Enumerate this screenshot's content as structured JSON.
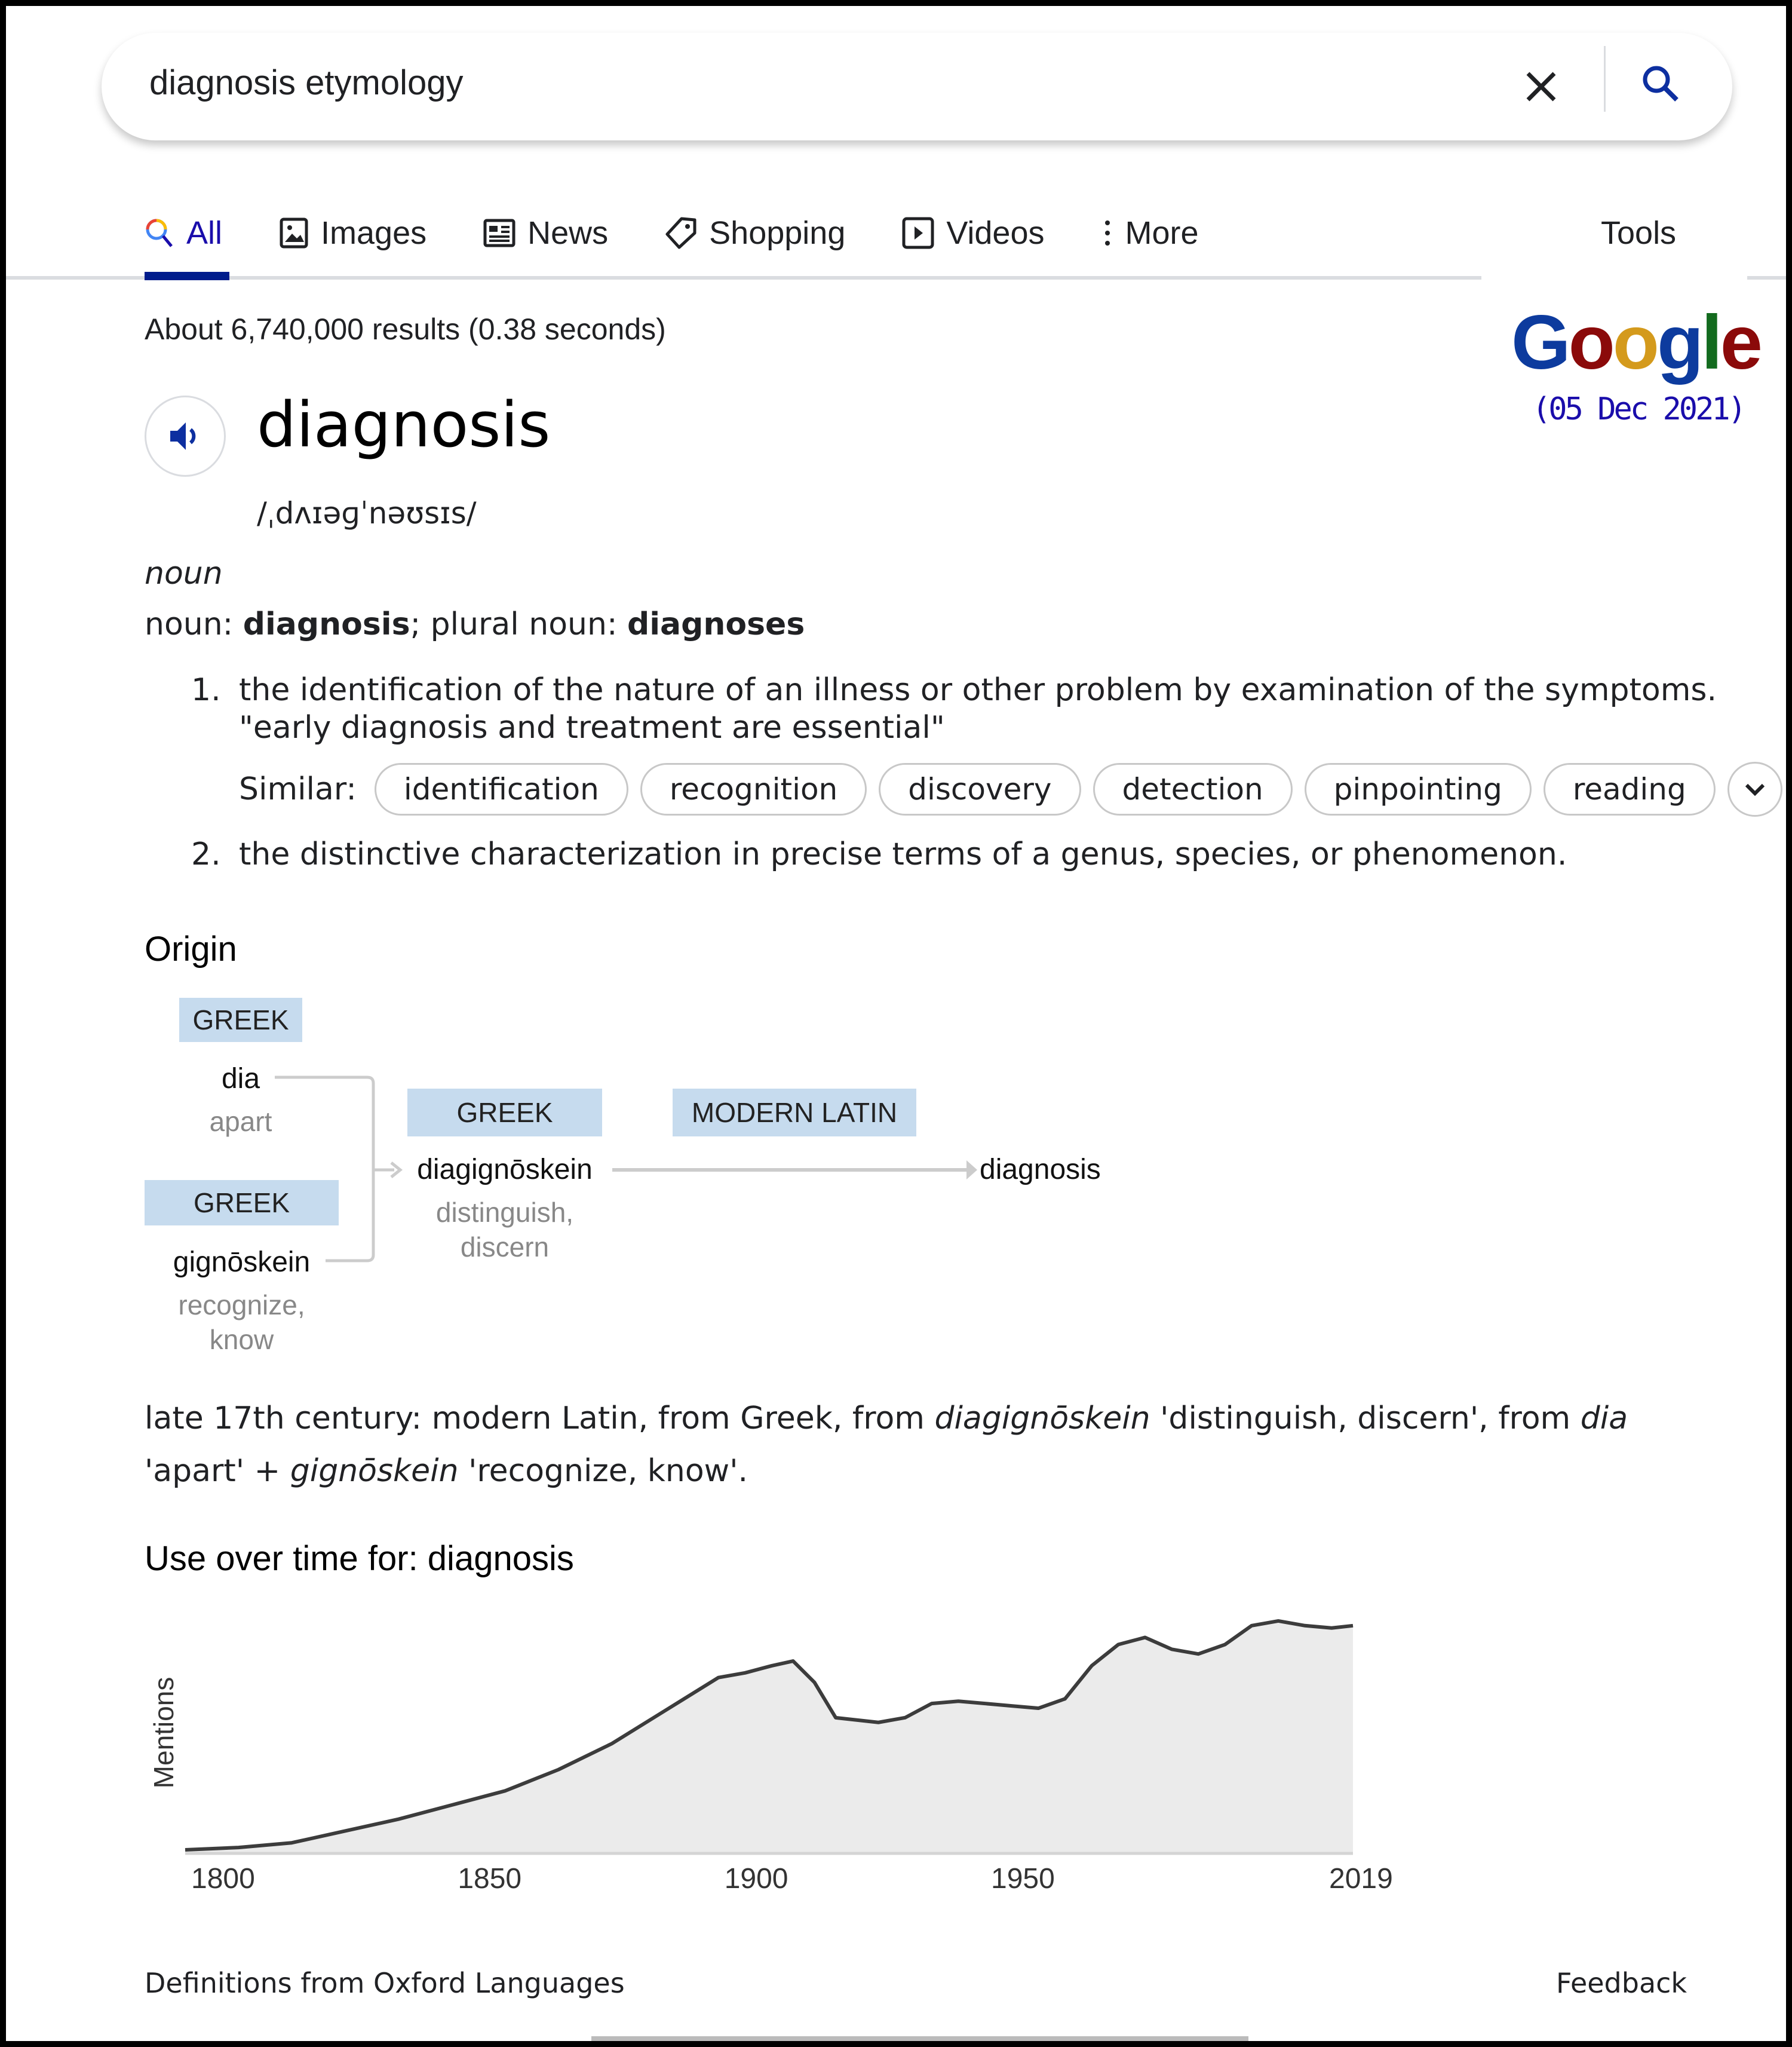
{
  "search": {
    "query": "diagnosis etymology",
    "clear_icon": "close-icon",
    "search_icon": "search-icon"
  },
  "tabs": [
    {
      "label": "All",
      "icon": "search-icon",
      "active": true
    },
    {
      "label": "Images",
      "icon": "image-icon",
      "active": false
    },
    {
      "label": "News",
      "icon": "newspaper-icon",
      "active": false
    },
    {
      "label": "Shopping",
      "icon": "tag-icon",
      "active": false
    },
    {
      "label": "Videos",
      "icon": "play-icon",
      "active": false
    },
    {
      "label": "More",
      "icon": "more-vert-icon",
      "active": false
    }
  ],
  "tools_label": "Tools",
  "stats": "About 6,740,000 results (0.38 seconds)",
  "logo": {
    "letters": [
      {
        "ch": "G",
        "color": "#0d3b9e"
      },
      {
        "ch": "o",
        "color": "#8b0a0a"
      },
      {
        "ch": "o",
        "color": "#d49a1c"
      },
      {
        "ch": "g",
        "color": "#0d3b9e"
      },
      {
        "ch": "l",
        "color": "#136b1e"
      },
      {
        "ch": "e",
        "color": "#8b0a0a"
      }
    ],
    "date": "(05 Dec 2021)"
  },
  "dictionary": {
    "headword": "diagnosis",
    "phonetic": "/ˌdʌɪəɡˈnəʊsɪs/",
    "part_of_speech": "noun",
    "forms": {
      "label1": "noun: ",
      "singular": "diagnosis",
      "sep": "; plural noun: ",
      "plural": "diagnoses"
    },
    "definitions": [
      {
        "num": "1.",
        "text": "the identification of the nature of an illness or other problem by examination of the symptoms.",
        "example": "\"early diagnosis and treatment are essential\""
      },
      {
        "num": "2.",
        "text": "the distinctive characterization in precise terms of a genus, species, or phenomenon."
      }
    ],
    "similar_label": "Similar:",
    "similar": [
      "identification",
      "recognition",
      "discovery",
      "detection",
      "pinpointing",
      "reading"
    ]
  },
  "origin": {
    "title": "Origin",
    "nodes": {
      "dia": {
        "lang": "GREEK",
        "word": "dia",
        "gloss": "apart"
      },
      "gignoskein": {
        "lang": "GREEK",
        "word": "gignōskein",
        "gloss1": "recognize,",
        "gloss2": "know"
      },
      "diagignoskein": {
        "lang": "GREEK",
        "word": "diagignōskein",
        "gloss1": "distinguish,",
        "gloss2": "discern"
      },
      "modern_latin": {
        "lang": "MODERN LATIN"
      },
      "diagnosis": {
        "word": "diagnosis"
      }
    },
    "etymology": {
      "p1": "late 17th century: modern Latin, from Greek, from ",
      "i1": "diagignōskein",
      "p2": " 'distinguish, discern', from ",
      "i2": "dia",
      "p3": " 'apart' + ",
      "i3": "gignōskein",
      "p4": " 'recognize, know'."
    }
  },
  "chart_data": {
    "type": "area",
    "title": "Use over time for: diagnosis",
    "xlabel": "",
    "ylabel": "Mentions",
    "x_ticks": [
      1800,
      1850,
      1900,
      1950,
      2019
    ],
    "xlim": [
      1800,
      2019
    ],
    "ylim": [
      0,
      100
    ],
    "y_units": "relative (normalized, axis unlabeled)",
    "grid": false,
    "x": [
      1800,
      1810,
      1820,
      1830,
      1840,
      1850,
      1860,
      1870,
      1880,
      1890,
      1900,
      1905,
      1910,
      1914,
      1918,
      1922,
      1930,
      1935,
      1940,
      1945,
      1950,
      1955,
      1960,
      1965,
      1970,
      1975,
      1980,
      1985,
      1990,
      1995,
      2000,
      2005,
      2010,
      2015,
      2019
    ],
    "values": [
      1,
      2,
      4,
      9,
      14,
      20,
      26,
      35,
      46,
      60,
      74,
      76,
      79,
      81,
      72,
      57,
      55,
      57,
      63,
      64,
      63,
      62,
      61,
      65,
      79,
      88,
      91,
      86,
      84,
      88,
      96,
      98,
      96,
      95,
      96
    ]
  },
  "footer": {
    "source": "Definitions from Oxford Languages",
    "feedback": "Feedback"
  }
}
